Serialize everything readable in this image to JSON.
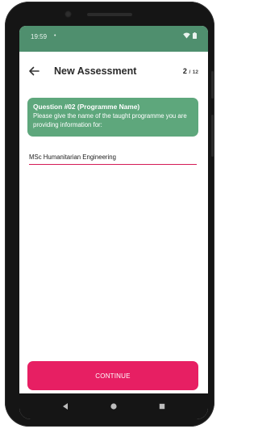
{
  "status_bar": {
    "time": "19:59",
    "dot": "•",
    "icons": [
      "wifi-icon",
      "battery-icon"
    ]
  },
  "toolbar": {
    "back_icon": "arrow-left-icon",
    "title": "New Assessment",
    "step_current": "2",
    "step_separator": "/",
    "step_total": "12"
  },
  "question": {
    "title": "Question #02 (Programme Name)",
    "text": "Please give the name of the taught programme you are providing information for:"
  },
  "answer": {
    "value": "MSc Humanitarian Engineering"
  },
  "actions": {
    "continue_label": "CONTINUE"
  },
  "nav": {
    "icons": [
      "back-triangle-icon",
      "home-circle-icon",
      "recents-square-icon"
    ]
  },
  "colors": {
    "header_green": "#4f8f6e",
    "card_green": "#5ea77c",
    "accent_pink": "#e71f63",
    "underline": "#d51b56"
  }
}
